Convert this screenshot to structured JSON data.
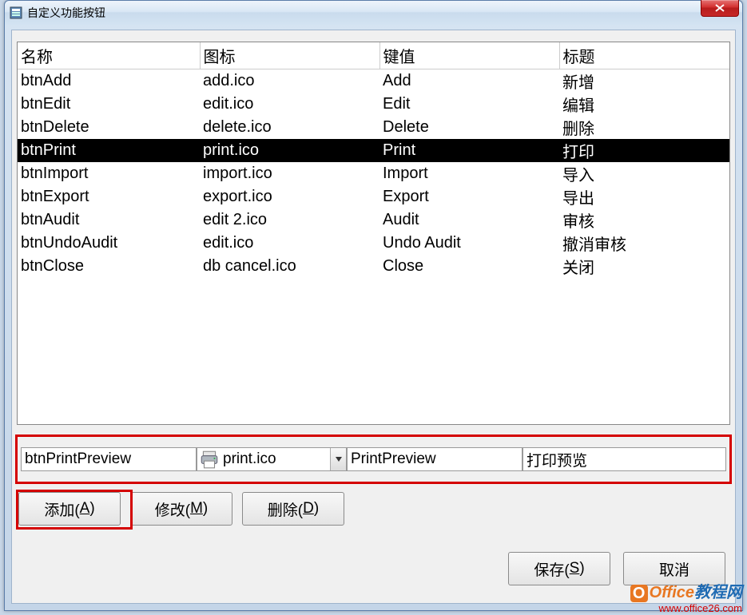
{
  "window": {
    "title": "自定义功能按钮"
  },
  "table": {
    "headers": {
      "name": "名称",
      "icon": "图标",
      "key": "键值",
      "caption": "标题"
    },
    "rows": [
      {
        "name": "btnAdd",
        "icon": "add.ico",
        "key": "Add",
        "caption": "新增",
        "selected": false
      },
      {
        "name": "btnEdit",
        "icon": "edit.ico",
        "key": "Edit",
        "caption": "编辑",
        "selected": false
      },
      {
        "name": "btnDelete",
        "icon": "delete.ico",
        "key": "Delete",
        "caption": "删除",
        "selected": false
      },
      {
        "name": "btnPrint",
        "icon": "print.ico",
        "key": "Print",
        "caption": "打印",
        "selected": true
      },
      {
        "name": "btnImport",
        "icon": "import.ico",
        "key": "Import",
        "caption": "导入",
        "selected": false
      },
      {
        "name": "btnExport",
        "icon": "export.ico",
        "key": "Export",
        "caption": "导出",
        "selected": false
      },
      {
        "name": "btnAudit",
        "icon": "edit 2.ico",
        "key": "Audit",
        "caption": "审核",
        "selected": false
      },
      {
        "name": "btnUndoAudit",
        "icon": "edit.ico",
        "key": "Undo Audit",
        "caption": "撤消审核",
        "selected": false
      },
      {
        "name": "btnClose",
        "icon": "db cancel.ico",
        "key": "Close",
        "caption": "关闭",
        "selected": false
      }
    ]
  },
  "inputs": {
    "name": "btnPrintPreview",
    "icon": "print.ico",
    "key": "PrintPreview",
    "caption": "打印预览"
  },
  "buttons": {
    "add": "添加(A)",
    "add_plain": "添加(",
    "add_key": "A",
    "modify_plain": "修改(",
    "modify_key": "M",
    "delete_plain": "删除(",
    "delete_key": "D",
    "save_plain": "保存(",
    "save_key": "S",
    "cancel": "取消",
    "close_paren": ")"
  },
  "watermark": {
    "badge": "O",
    "brand1": "Office",
    "brand2": "教程网",
    "url": "www.office26.com"
  }
}
